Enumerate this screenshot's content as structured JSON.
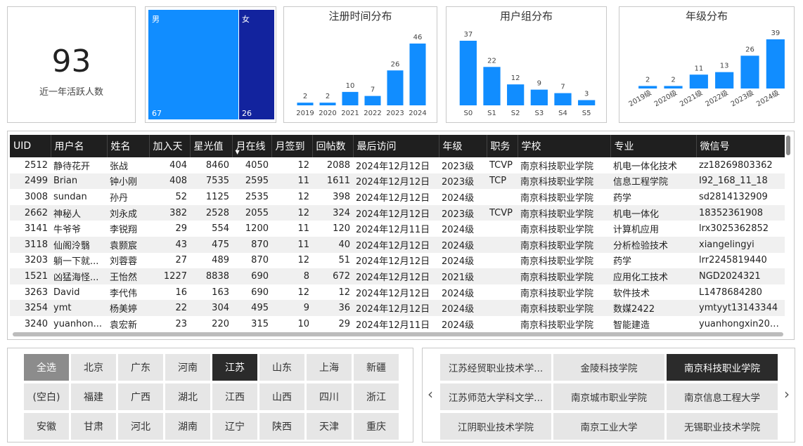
{
  "kpi": {
    "value": "93",
    "label": "近一年活跃人数"
  },
  "gender": {
    "male_label": "男",
    "male_value": "67",
    "female_label": "女",
    "female_value": "26",
    "colors": {
      "male": "#118DFF",
      "female": "#12239E"
    }
  },
  "chart_data": [
    {
      "type": "bar",
      "title": "注册时间分布",
      "categories": [
        "2019",
        "2020",
        "2021",
        "2022",
        "2023",
        "2024"
      ],
      "values": [
        2,
        2,
        10,
        7,
        26,
        46
      ],
      "color": "#118DFF"
    },
    {
      "type": "bar",
      "title": "用户组分布",
      "categories": [
        "S0",
        "S1",
        "S2",
        "S3",
        "S4",
        "S5"
      ],
      "values": [
        37,
        22,
        12,
        9,
        7,
        3
      ],
      "color": "#118DFF"
    },
    {
      "type": "bar",
      "title": "年级分布",
      "categories": [
        "2019级",
        "2020级",
        "2021级",
        "2022级",
        "2023级",
        "2024级"
      ],
      "values": [
        2,
        2,
        11,
        13,
        26,
        39
      ],
      "color": "#118DFF"
    }
  ],
  "table": {
    "columns": [
      "UID",
      "用户名",
      "姓名",
      "加入天",
      "星光值",
      "月在线",
      "月签到",
      "回帖数",
      "最后访问",
      "年级",
      "职务",
      "学校",
      "专业",
      "微信号"
    ],
    "sorted_column": "月在线",
    "rows": [
      [
        "2512",
        "静待花开",
        "张战",
        "404",
        "8460",
        "4050",
        "12",
        "2088",
        "2024年12月12日",
        "2023级",
        "TCVP",
        "南京科技职业学院",
        "机电一体化技术",
        "zz18269803362"
      ],
      [
        "2499",
        "Brian",
        "钟小刚",
        "408",
        "7535",
        "2595",
        "11",
        "1611",
        "2024年12月12日",
        "2023级",
        "TCP",
        "南京科技职业学院",
        "信息工程学院",
        "I92_168_11_18"
      ],
      [
        "3008",
        "sundan",
        "孙丹",
        "52",
        "1125",
        "2535",
        "12",
        "398",
        "2024年12月12日",
        "2024级",
        "",
        "南京科技职业学院",
        "药学",
        "sd2814132909"
      ],
      [
        "2662",
        "神秘人",
        "刘永成",
        "382",
        "2528",
        "2055",
        "12",
        "324",
        "2024年12月12日",
        "2023级",
        "TCVP",
        "南京科技职业学院",
        "机电一体化",
        "18352361908"
      ],
      [
        "3141",
        "牛爷爷",
        "李锐翔",
        "29",
        "554",
        "1200",
        "11",
        "120",
        "2024年12月11日",
        "2024级",
        "",
        "南京科技职业学院",
        "计算机应用",
        "lrx3025362852"
      ],
      [
        "3118",
        "仙阁泠翳",
        "袁颢宸",
        "43",
        "475",
        "870",
        "11",
        "40",
        "2024年12月12日",
        "2024级",
        "",
        "南京科技职业学院",
        "分析检验技术",
        "xiangelingyi"
      ],
      [
        "3203",
        "躺一下就...",
        "刘蓉蓉",
        "27",
        "489",
        "870",
        "12",
        "51",
        "2024年12月12日",
        "2024级",
        "",
        "南京科技职业学院",
        "药学",
        "lrr2245819440"
      ],
      [
        "1521",
        "凶猛海怪...",
        "王怡然",
        "1227",
        "8838",
        "690",
        "8",
        "672",
        "2024年12月12日",
        "2021级",
        "",
        "南京科技职业学院",
        "应用化工技术",
        "NGD2024321"
      ],
      [
        "3263",
        "David",
        "李代伟",
        "16",
        "163",
        "690",
        "12",
        "12",
        "2024年12月12日",
        "2024级",
        "",
        "南京科技职业学院",
        "软件技术",
        "L1478684280"
      ],
      [
        "3254",
        "ymt",
        "杨美婷",
        "22",
        "304",
        "495",
        "9",
        "36",
        "2024年12月12日",
        "2024级",
        "",
        "南京科技职业学院",
        "数媒2422",
        "ymtyyt13143344"
      ],
      [
        "3240",
        "yuanhon...",
        "袁宏新",
        "23",
        "220",
        "315",
        "10",
        "29",
        "2024年12月11日",
        "2024级",
        "",
        "南京科技职业学院",
        "智能建造",
        "yuanhongxin200..."
      ]
    ]
  },
  "province_slicer": {
    "items": [
      "全选",
      "北京",
      "广东",
      "河南",
      "江苏",
      "山东",
      "上海",
      "新疆",
      "(空白)",
      "福建",
      "广西",
      "湖北",
      "江西",
      "山西",
      "四川",
      "浙江",
      "安徽",
      "甘肃",
      "河北",
      "湖南",
      "辽宁",
      "陕西",
      "天津",
      "重庆"
    ],
    "selected": "江苏"
  },
  "school_slicer": {
    "items": [
      "江苏经贸职业技术学...",
      "金陵科技学院",
      "南京科技职业学院",
      "江苏师范大学科文学...",
      "南京城市职业学院",
      "南京信息工程大学",
      "江阴职业技术学院",
      "南京工业大学",
      "无锡职业技术学院"
    ],
    "selected": "南京科技职业学院",
    "prev": "‹",
    "next": "›"
  }
}
